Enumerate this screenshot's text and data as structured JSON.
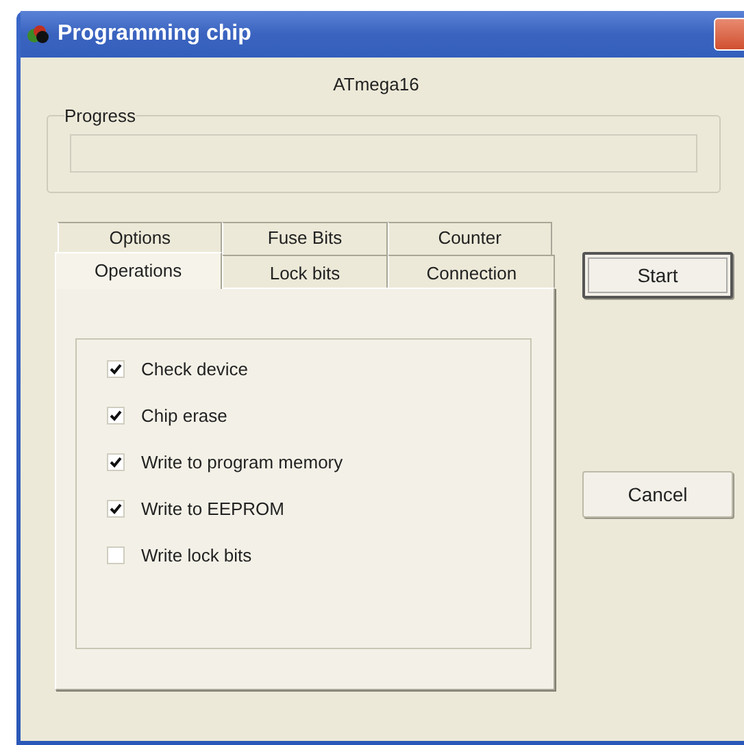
{
  "window": {
    "title": "Programming chip"
  },
  "device": "ATmega16",
  "progress": {
    "label": "Progress",
    "level": 0
  },
  "tab_rows": [
    {
      "tabs": [
        {
          "label": "Options",
          "selected": false
        },
        {
          "label": "Fuse Bits",
          "selected": false
        },
        {
          "label": "Counter",
          "selected": false
        }
      ]
    },
    {
      "tabs": [
        {
          "label": "Operations",
          "selected": true
        },
        {
          "label": "Lock bits",
          "selected": false
        },
        {
          "label": "Connection",
          "selected": false
        }
      ]
    }
  ],
  "operations": [
    {
      "label": "Check device",
      "checked": true
    },
    {
      "label": "Chip erase",
      "checked": true
    },
    {
      "label": "Write to program memory",
      "checked": true
    },
    {
      "label": "Write to EEPROM",
      "checked": true
    },
    {
      "label": "Write lock bits",
      "checked": false
    }
  ],
  "buttons": [
    {
      "label": "Start",
      "kind": "default"
    },
    {
      "label": "Cancel",
      "kind": "normal"
    }
  ]
}
